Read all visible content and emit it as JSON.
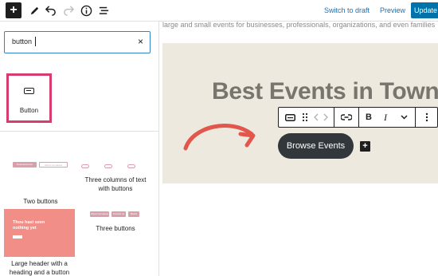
{
  "topbar": {
    "inserter_symbol": "+",
    "switch_to_draft": "Switch to draft",
    "preview": "Preview",
    "update": "Update",
    "icons": [
      "pencil-icon",
      "undo-icon",
      "redo-icon",
      "info-icon",
      "list-view-icon"
    ]
  },
  "inserter": {
    "search": {
      "value": "button",
      "clear_symbol": "×"
    },
    "blocks": [
      {
        "label": "Button",
        "icon": "button-block-icon",
        "highlight_color": "#d63c71"
      }
    ],
    "patterns": [
      {
        "label": "Two buttons",
        "preview_buttons": [
          "Download now",
          "About Cervantes"
        ]
      },
      {
        "label": "Three columns of text with buttons",
        "preview_buttons": [
          "Learn",
          "Learn",
          "Learn"
        ]
      },
      {
        "label": "Large header with a heading and a button",
        "preview_text": "Thou hast seen nothing yet"
      },
      {
        "label": "Three buttons",
        "preview_buttons": [
          "About Cervantes",
          "Contact us",
          "Books"
        ]
      }
    ]
  },
  "canvas": {
    "intro_text": "large and small events for businesses, professionals, organizations, and even families",
    "cover_title": "Best Events in Town",
    "browse_button": "Browse Events",
    "add_symbol": "+",
    "cover_color": "#ede9de",
    "button_color": "#32373c",
    "arrow_color": "#e2574c",
    "toolbar": {
      "bold": "B",
      "italic": "I",
      "icons": [
        "button-block-icon",
        "drag-handle-icon",
        "move-left-icon",
        "move-right-icon",
        "link-icon",
        "bold-icon",
        "italic-icon",
        "chevron-down-icon",
        "more-options-icon"
      ]
    }
  }
}
